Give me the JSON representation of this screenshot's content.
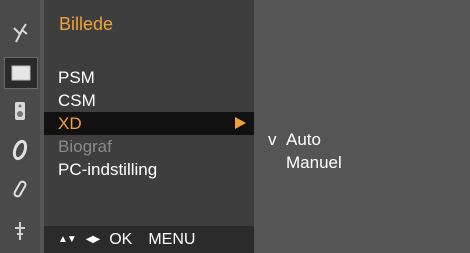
{
  "menu": {
    "title": "Billede",
    "items": [
      {
        "label": "PSM"
      },
      {
        "label": "CSM"
      },
      {
        "label": "XD"
      },
      {
        "label": "Biograf"
      },
      {
        "label": "PC-indstilling"
      }
    ]
  },
  "submenu": {
    "items": [
      {
        "check": "v",
        "label": "Auto"
      },
      {
        "check": "",
        "label": "Manuel"
      }
    ]
  },
  "footer": {
    "updown": "▲▼",
    "leftright": "◀▶",
    "ok": "OK",
    "menu": "MENU"
  },
  "icons": [
    "antenna-icon",
    "picture-icon",
    "sound-icon",
    "time-icon",
    "option-icon",
    "input-icon"
  ],
  "colors": {
    "accent": "#f0a23a",
    "panel": "#3e3e3e",
    "background": "#555555"
  }
}
